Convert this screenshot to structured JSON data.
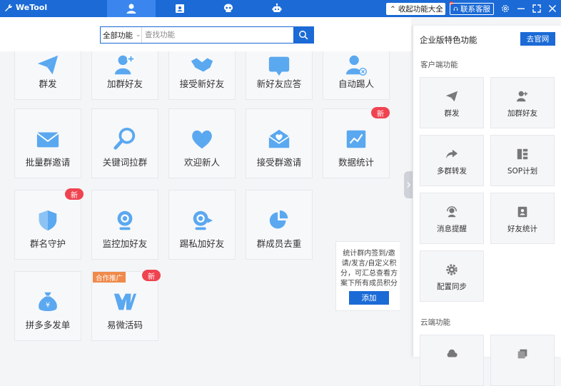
{
  "app": {
    "title": "WeTool"
  },
  "titlebar": {
    "collapse_label": "收起功能大全",
    "service_label": "联系客服"
  },
  "search": {
    "category": "全部功能",
    "placeholder": "查找功能"
  },
  "features": [
    {
      "label": "群发",
      "icon": "paper-plane-icon"
    },
    {
      "label": "加群好友",
      "icon": "add-user-icon"
    },
    {
      "label": "接受新好友",
      "icon": "handshake-icon"
    },
    {
      "label": "新好友应答",
      "icon": "chat-bubble-icon"
    },
    {
      "label": "自动踢人",
      "icon": "remove-user-icon"
    },
    {
      "label": "批量群邀请",
      "icon": "envelope-icon"
    },
    {
      "label": "关键词拉群",
      "icon": "magnifier-icon"
    },
    {
      "label": "欢迎新人",
      "icon": "heart-icon"
    },
    {
      "label": "接受群邀请",
      "icon": "heart-envelope-icon"
    },
    {
      "label": "数据统计",
      "icon": "chart-icon",
      "badge": "新"
    },
    {
      "label": "群名守护",
      "icon": "shield-icon",
      "badge": "新"
    },
    {
      "label": "监控加好友",
      "icon": "webcam-icon"
    },
    {
      "label": "踢私加好友",
      "icon": "webcam-kick-icon"
    },
    {
      "label": "群成员去重",
      "icon": "pie-icon"
    },
    {
      "label": "拼多多发单",
      "icon": "money-bag-icon"
    },
    {
      "label": "易微活码",
      "icon": "xv-logo-icon",
      "badge": "新",
      "tag": "合作推广"
    }
  ],
  "tip": {
    "text": "统计群内签到/邀请/发言/自定义积分，可汇总查看方案下所有成员积分",
    "button": "添加"
  },
  "panel": {
    "title": "企业版特色功能",
    "button": "去官网",
    "section1": "客户端功能",
    "section2": "云端功能",
    "items": [
      {
        "label": "群发",
        "icon": "paper-plane-icon"
      },
      {
        "label": "加群好友",
        "icon": "add-user-icon"
      },
      {
        "label": "多群转发",
        "icon": "forward-icon"
      },
      {
        "label": "SOP计划",
        "icon": "plan-icon"
      },
      {
        "label": "消息提醒",
        "icon": "headset-icon"
      },
      {
        "label": "好友统计",
        "icon": "contact-book-icon"
      },
      {
        "label": "配置同步",
        "icon": "gear-icon"
      }
    ]
  },
  "colors": {
    "accent": "#1b6ad6",
    "icon": "#5aa8f0",
    "badge": "#ef4350",
    "coop": "#f08a4b"
  }
}
